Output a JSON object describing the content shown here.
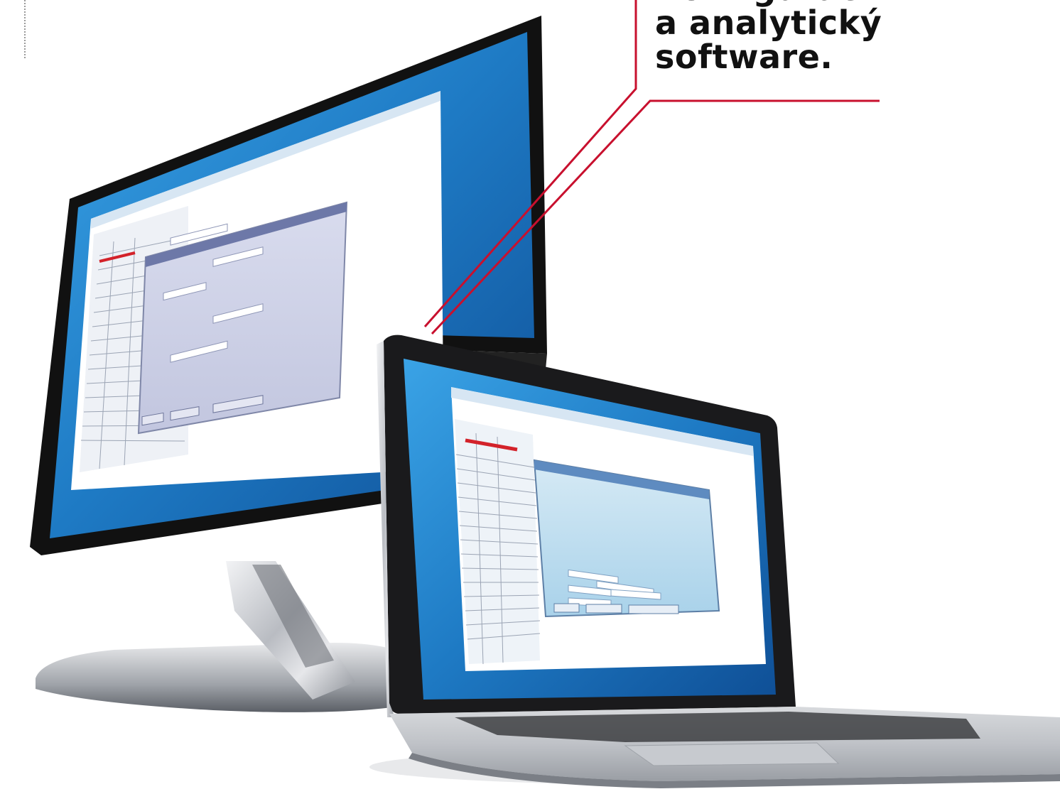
{
  "caption": {
    "line1": "Konfigurační",
    "line2": "a analytický",
    "line3": "software."
  },
  "colors": {
    "callout_line": "#c8102e",
    "bezel": "#111111",
    "screen_blue": "#1f7fc6",
    "window_face": "#cfd3e8",
    "silver": "#c9ccd1"
  },
  "devices": [
    "monitor",
    "laptop"
  ]
}
